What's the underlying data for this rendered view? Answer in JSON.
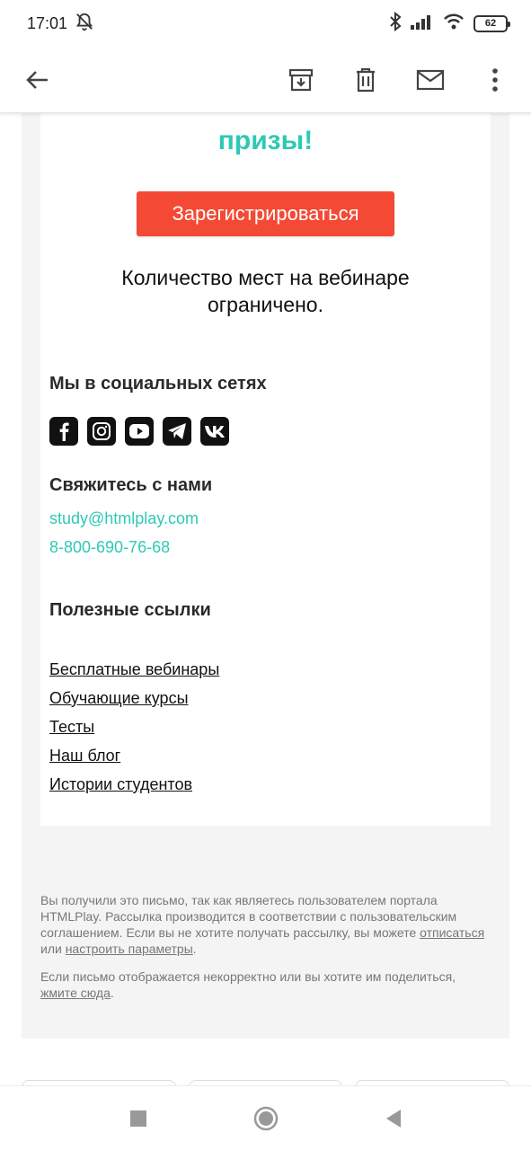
{
  "status_bar": {
    "time": "17:01",
    "battery": "62"
  },
  "email": {
    "prizes_text": "призы!",
    "register_button": "Зарегистрироваться",
    "limited_text": "Количество мест на вебинаре ограничено.",
    "social_title": "Мы в социальных сетях",
    "social_icons": [
      "facebook-icon",
      "instagram-icon",
      "youtube-icon",
      "telegram-icon",
      "vk-icon"
    ],
    "contact_title": "Свяжитесь с нами",
    "contact_email": "study@htmlplay.com",
    "contact_phone": "8-800-690-76-68",
    "links_title": "Полезные ссылки",
    "links": [
      "Бесплатные вебинары",
      "Обучающие курсы",
      "Тесты",
      "Наш блог",
      "Истории студентов"
    ]
  },
  "footer": {
    "p1_text1": "Вы получили это письмо, так как являетесь пользователем портала HTMLPlay. Рассылка производится в соответствии с пользовательским соглашением. Если вы не хотите получать рассылку, вы можете ",
    "unsubscribe": "отписаться",
    "p1_text2": " или ",
    "settings": "настроить параметры",
    "p1_text3": ".",
    "p2_text1": "Если письмо отображается некорректно или вы хотите им поделиться, ",
    "click_here": "жмите сюда",
    "p2_text2": "."
  },
  "colors": {
    "accent": "#2ec9b4",
    "button": "#f44a35",
    "outer_bg": "#f4f4f4"
  }
}
